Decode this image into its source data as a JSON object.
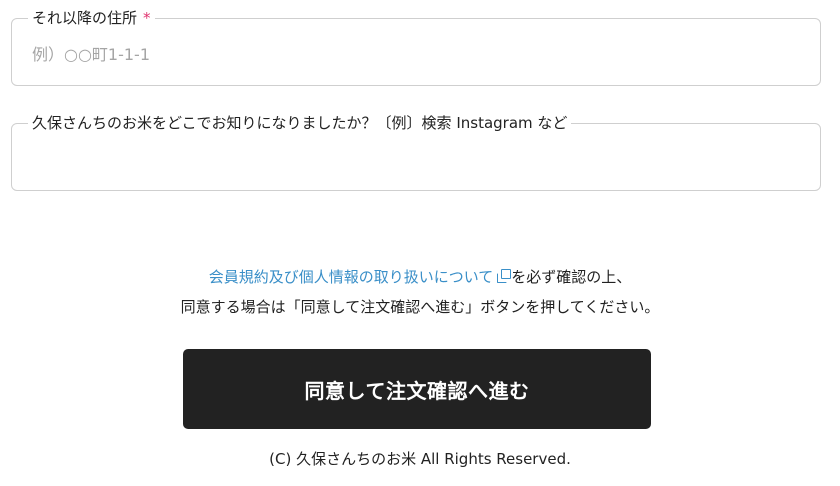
{
  "form": {
    "address": {
      "label": "それ以降の住所",
      "required_mark": "*",
      "placeholder": "例）○○町1-1-1",
      "value": ""
    },
    "source": {
      "label": "久保さんちのお米をどこでお知りになりましたか？〔例〕検索 Instagram など",
      "value": ""
    }
  },
  "notice": {
    "link_text": "会員規約及び個人情報の取り扱いについて",
    "link_icon": "external-link-icon",
    "after_link": "を必ず確認の上、",
    "line2": "同意する場合は「同意して注文確認へ進む」ボタンを押してください。"
  },
  "submit_label": "同意して注文確認へ進む",
  "footer": "(C) 久保さんちのお米 All Rights Reserved.",
  "colors": {
    "required": "#e0336f",
    "link": "#3a8fc8",
    "button_bg": "#222222",
    "border": "#cfcfcf"
  }
}
